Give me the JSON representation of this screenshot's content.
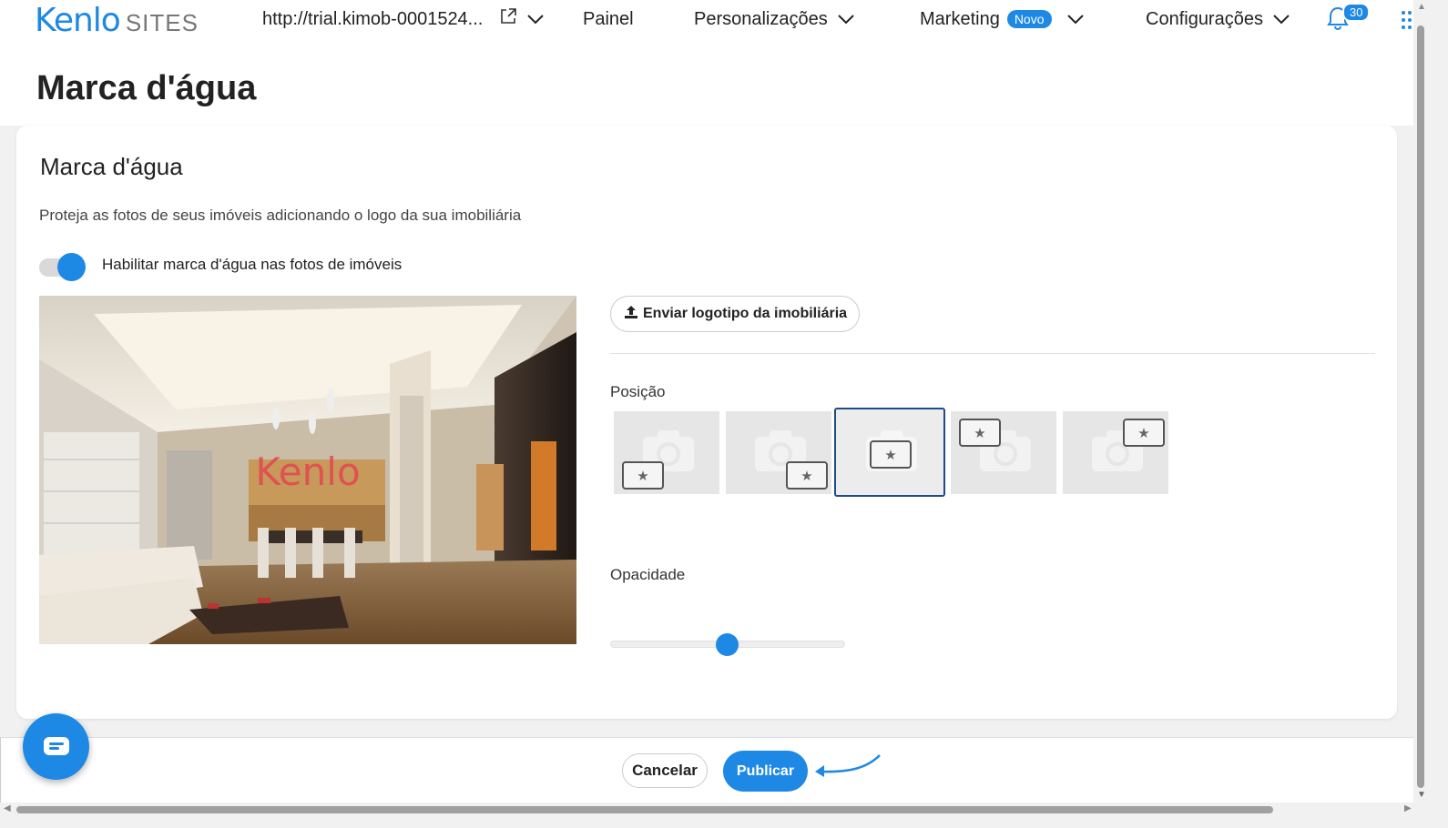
{
  "header": {
    "brand": "Kenlo",
    "brand_suffix": "SITES",
    "url": "http://trial.kimob-0001524...",
    "nav": {
      "painel": "Painel",
      "personalizacoes": "Personalizações",
      "marketing": "Marketing",
      "marketing_badge": "Novo",
      "configuracoes": "Configurações"
    },
    "notifications_count": "30"
  },
  "page": {
    "title": "Marca d'água"
  },
  "card": {
    "title": "Marca d'água",
    "description": "Proteja as fotos de seus imóveis adicionando o logo da sua imobiliária",
    "toggle_label": "Habilitar marca d'água nas fotos de imóveis",
    "toggle_on": true,
    "preview_watermark": "Kenlo",
    "upload_button": "Enviar logotipo da imobiliária",
    "position_label": "Posição",
    "positions": [
      {
        "id": "bottom-left",
        "selected": false
      },
      {
        "id": "bottom-right",
        "selected": false
      },
      {
        "id": "center",
        "selected": true
      },
      {
        "id": "top-left",
        "selected": false
      },
      {
        "id": "top-right",
        "selected": false
      }
    ],
    "opacity_label": "Opacidade",
    "opacity_value": 0.5
  },
  "footer": {
    "cancel": "Cancelar",
    "publish": "Publicar"
  },
  "colors": {
    "accent": "#1e88e5",
    "selected_border": "#1e4d86",
    "watermark": "#e5404f"
  }
}
